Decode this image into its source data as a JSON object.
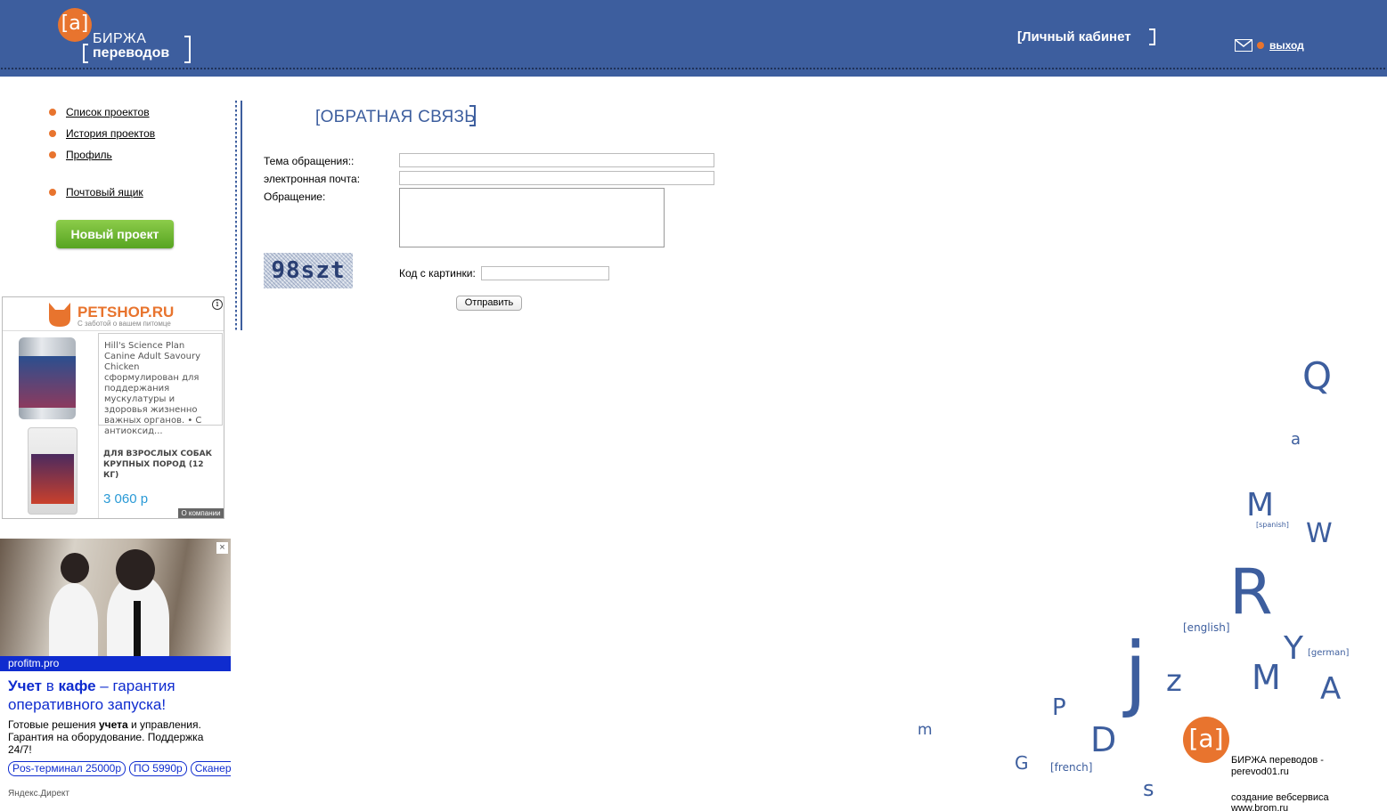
{
  "header": {
    "logo_mark": "[a]",
    "logo_line1": "БИРЖА",
    "logo_line2": "переводов",
    "cabinet": "[Личный кабинет",
    "logout": "выход",
    "icons": {
      "mail": "mail-icon"
    },
    "colors": {
      "header_bg": "#3d5e9e",
      "accent": "#e8742e"
    }
  },
  "sidebar": {
    "items": [
      {
        "label": "Список проектов"
      },
      {
        "label": "История проектов"
      },
      {
        "label": "Профиль"
      },
      {
        "label": "Почтовый ящик"
      }
    ],
    "new_project": "Новый проект"
  },
  "form": {
    "title": "[ОБРАТНАЯ СВЯЗЬ",
    "subject_label": "Тема обращения::",
    "email_label": "электронная почта:",
    "message_label": "Обращение:",
    "subject_value": "",
    "email_value": "",
    "message_value": "",
    "captcha_text": "98szt",
    "code_label": "Код с картинки:",
    "code_value": "",
    "submit": "Отправить"
  },
  "ad1": {
    "brand": "PETSHOP.RU",
    "tagline": "С заботой о вашем питомце",
    "product_text": "Hill's Science Plan Canine Adult Savoury Chicken сформулирован для поддержания мускулатуры и здоровья жизненно важных органов. • С антиоксид...",
    "product2_text": "ДЛЯ ВЗРОСЛЫХ СОБАК КРУПНЫХ ПОРОД (12 КГ)",
    "price": "3 060 р",
    "about": "О компании",
    "info": "i"
  },
  "ad2": {
    "domain": "profitm.pro",
    "title_b1": "Учет",
    "title_m1": " в ",
    "title_b2": "кафе",
    "title_m2": " – гарантия оперативного запуска!",
    "text_pre": "Готовые решения ",
    "text_bold": "учета",
    "text_post": " и управления. Гарантия на оборудование. Поддержка 24/7!",
    "chips": [
      "Pos-терминал 25000р",
      "ПО 5990р",
      "Сканер штрихкодов"
    ],
    "yandex": "Яндекс.Директ",
    "close": "×"
  },
  "cloud": {
    "letters": [
      "Q",
      "a",
      "M",
      "W",
      "R",
      "Y",
      "j",
      "z",
      "M",
      "A",
      "P",
      "m",
      "D",
      "G",
      "s"
    ],
    "langs": [
      "[spanish]",
      "[english]",
      "[german]",
      "[french]"
    ]
  },
  "footer": {
    "mark": "[a]",
    "line1": "БИРЖА переводов -",
    "line2": "perevod01.ru",
    "line3": "создание вебсервиса",
    "line4": "www.brom.ru"
  }
}
